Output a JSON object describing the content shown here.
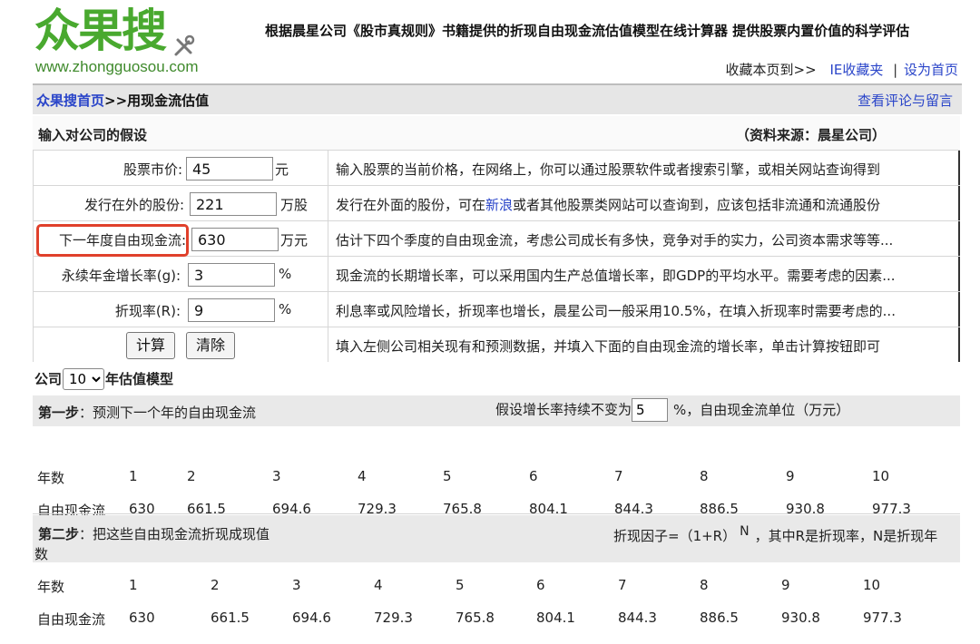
{
  "header": {
    "logo_text": "众果搜",
    "logo_url": "www.zhongguosou.com",
    "slogan": "根据晨星公司《股市真规则》书籍提供的折现自由现金流估值模型在线计算器 提供股票内置价值的科学评估",
    "bookmark_prefix": "收藏本页到>>",
    "ie_bookmark": "IE收藏夹",
    "set_home": "设为首页",
    "divider": "|"
  },
  "nav": {
    "home": "众果搜首页",
    "current": ">>用现金流估值",
    "review": "查看评论与留言"
  },
  "assumptions": {
    "title": "输入对公司的假设",
    "source": "（资料来源：晨星公司）",
    "rows": [
      {
        "label": "股票市价:",
        "value": "45",
        "unit": "元",
        "desc": "输入股票的当前价格，在网络上，你可以通过股票软件或者搜索引擎，或相关网站查询得到"
      },
      {
        "label": "发行在外的股份:",
        "value": "221",
        "unit": "万股",
        "desc_pre": "发行在外面的股份，可在",
        "desc_link": "新浪",
        "desc_post": "或者其他股票类网站可以查询到，应该包括非流通和流通股份"
      },
      {
        "label": "下一年度自由现金流:",
        "value": "630",
        "unit": "万元",
        "desc": "估计下四个季度的自由现金流，考虑公司成长有多快，竞争对手的实力，公司资本需求等等..."
      },
      {
        "label": "永续年金增长率(g):",
        "value": "3",
        "unit": "%",
        "desc": "现金流的长期增长率，可以采用国内生产总值增长率，即GDP的平均水平。需要考虑的因素..."
      },
      {
        "label": "折现率(R):",
        "value": "9",
        "unit": "%",
        "desc": "利息率或风险增长，折现率也增长，晨星公司一般采用10.5%，在填入折现率时需要考虑的..."
      }
    ],
    "calc_button": "计算",
    "clear_button": "清除",
    "action_desc": "填入左侧公司相关现有和预测数据，并填入下面的自由现金流的增长率，单击计算按钮即可"
  },
  "model": {
    "prefix": "公司",
    "years": "10",
    "suffix": "年估值模型"
  },
  "step1": {
    "title_bold": "第一步",
    "title_rest": "：预测下一个年的自由现金流",
    "growth_prefix": "假设增长率持续不变为",
    "growth_value": "5",
    "growth_suffix": "%，自由现金流单位（万元）",
    "year_label": "年数",
    "fcf_label": "自由现金流",
    "years": [
      "1",
      "2",
      "3",
      "4",
      "5",
      "6",
      "7",
      "8",
      "9",
      "10"
    ],
    "values": [
      "630",
      "661.5",
      "694.6",
      "729.3",
      "765.8",
      "804.1",
      "844.3",
      "886.5",
      "930.8",
      "977.3"
    ]
  },
  "step2": {
    "title_bold": "第二步",
    "title_rest": "：把这些自由现金流折现成现值",
    "title_wrap": "数",
    "factor_pre": "折现因子=（1+R）",
    "factor_sup": "N",
    "factor_post": "，其中R是折现率，N是折现年",
    "year_label": "年数",
    "fcf_label": "自由现金流",
    "years": [
      "1",
      "2",
      "3",
      "4",
      "5",
      "6",
      "7",
      "8",
      "9",
      "10"
    ],
    "values": [
      "630",
      "661.5",
      "694.6",
      "729.3",
      "765.8",
      "804.1",
      "844.3",
      "886.5",
      "930.8",
      "977.3"
    ]
  }
}
